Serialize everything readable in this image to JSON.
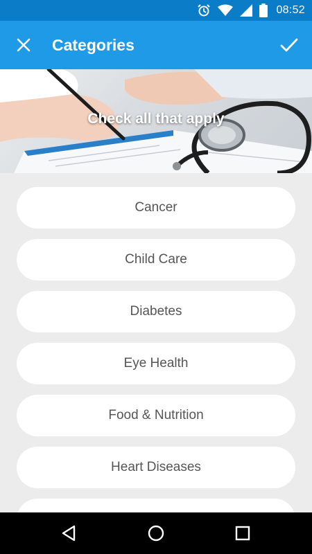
{
  "status_bar": {
    "time": "08:52",
    "icons": [
      "alarm-icon",
      "wifi-icon",
      "signal-icon",
      "battery-icon"
    ]
  },
  "app_bar": {
    "title": "Categories",
    "close_icon": "close-icon",
    "confirm_icon": "check-icon",
    "background": "#1e9ae6"
  },
  "banner": {
    "caption": "Check all that apply"
  },
  "categories": [
    "Cancer",
    "Child Care",
    "Diabetes",
    "Eye Health",
    "Food & Nutrition",
    "Heart Diseases"
  ],
  "nav_bar": {
    "icons": [
      "back-icon",
      "home-icon",
      "recents-icon"
    ]
  }
}
